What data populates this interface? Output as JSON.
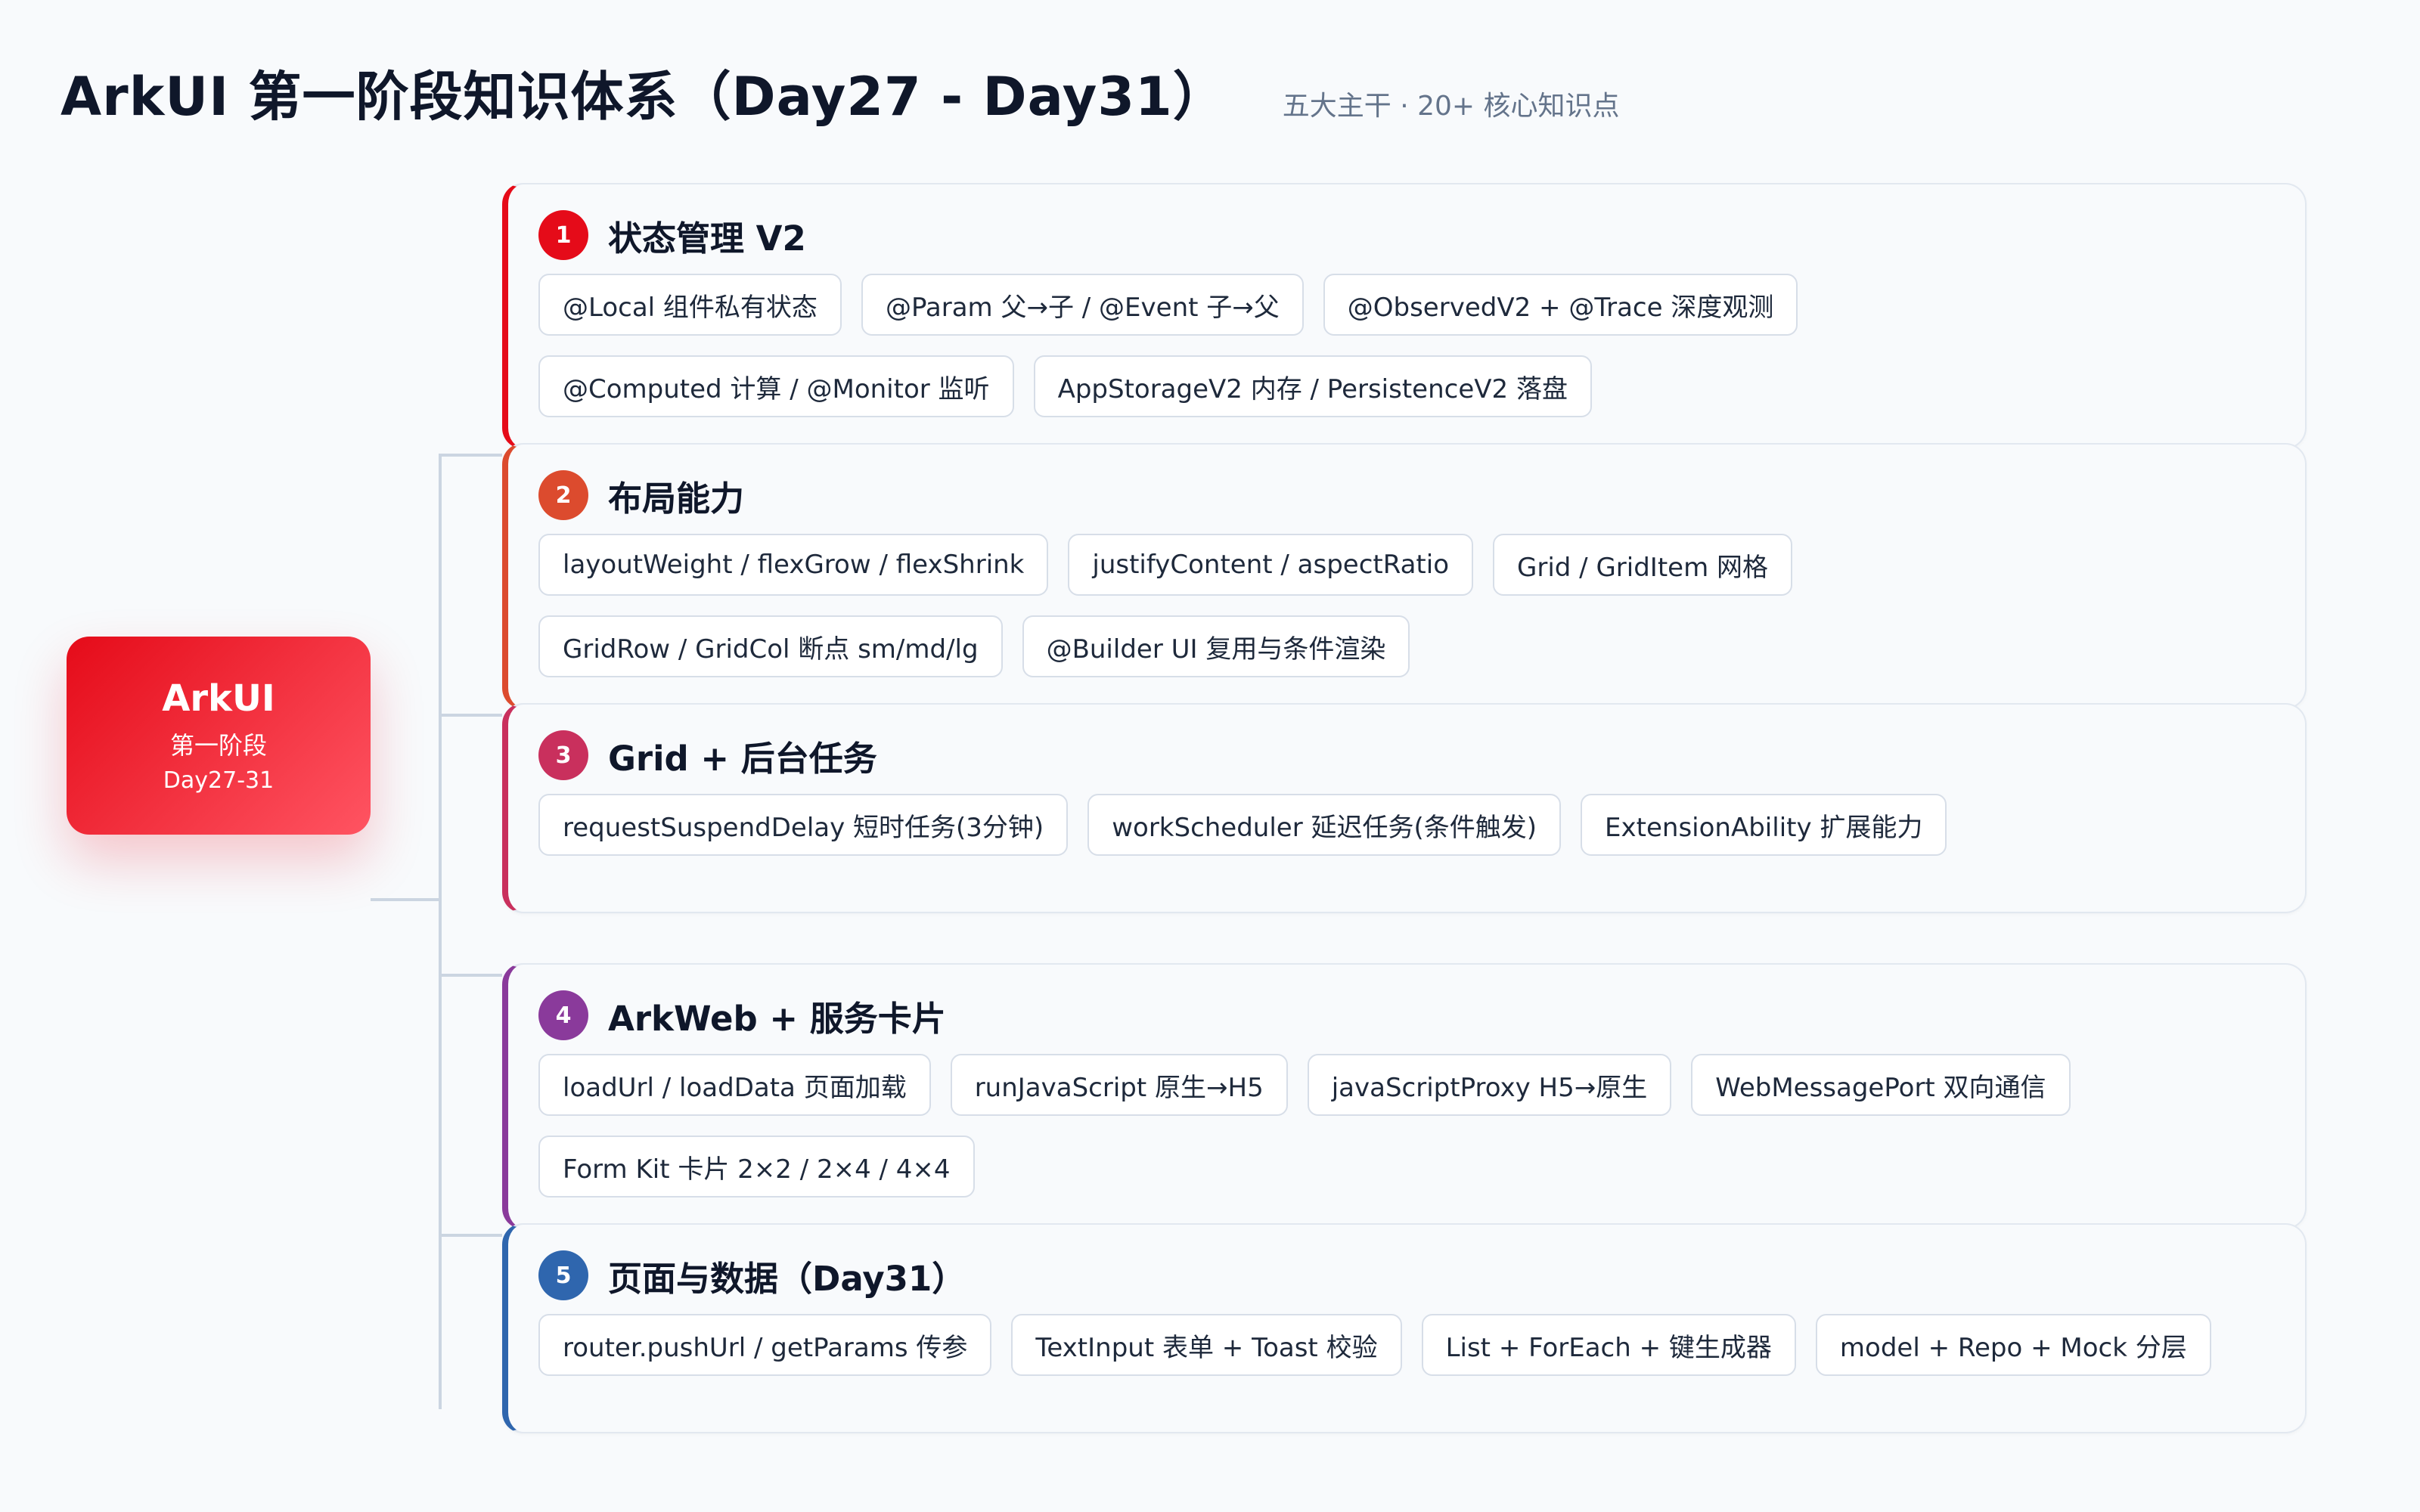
{
  "header": {
    "title": "ArkUI 第一阶段知识体系（Day27 - Day31）",
    "subtitle": "五大主干 · 20+ 核心知识点"
  },
  "root": {
    "title": "ArkUI",
    "line2": "第一阶段",
    "line3": "Day27-31"
  },
  "branches": [
    {
      "number": "1",
      "title": "状态管理 V2",
      "accent": "#e50b19",
      "items": [
        "@Local 组件私有状态",
        "@Param 父→子 / @Event 子→父",
        "@ObservedV2 + @Trace 深度观测",
        "@Computed 计算 / @Monitor 监听",
        "AppStorageV2 内存 / PersistenceV2 落盘"
      ]
    },
    {
      "number": "2",
      "title": "布局能力",
      "accent": "#dc4b2e",
      "items": [
        "layoutWeight / flexGrow / flexShrink",
        "justifyContent / aspectRatio",
        "Grid / GridItem 网格",
        "GridRow / GridCol 断点 sm/md/lg",
        "@Builder UI 复用与条件渲染"
      ]
    },
    {
      "number": "3",
      "title": "Grid + 后台任务",
      "accent": "#c9305d",
      "items": [
        "requestSuspendDelay 短时任务(3分钟)",
        "workScheduler 延迟任务(条件触发)",
        "ExtensionAbility 扩展能力"
      ]
    },
    {
      "number": "4",
      "title": "ArkWeb + 服务卡片",
      "accent": "#8a3a9b",
      "items": [
        "loadUrl / loadData 页面加载",
        "runJavaScript 原生→H5",
        "javaScriptProxy H5→原生",
        "WebMessagePort 双向通信",
        "Form Kit 卡片 2×2 / 2×4 / 4×4"
      ]
    },
    {
      "number": "5",
      "title": "页面与数据（Day31）",
      "accent": "#2f66ae",
      "items": [
        "router.pushUrl / getParams 传参",
        "TextInput 表单 + Toast 校验",
        "List + ForEach + 键生成器",
        "model + Repo + Mock 分层"
      ]
    }
  ]
}
